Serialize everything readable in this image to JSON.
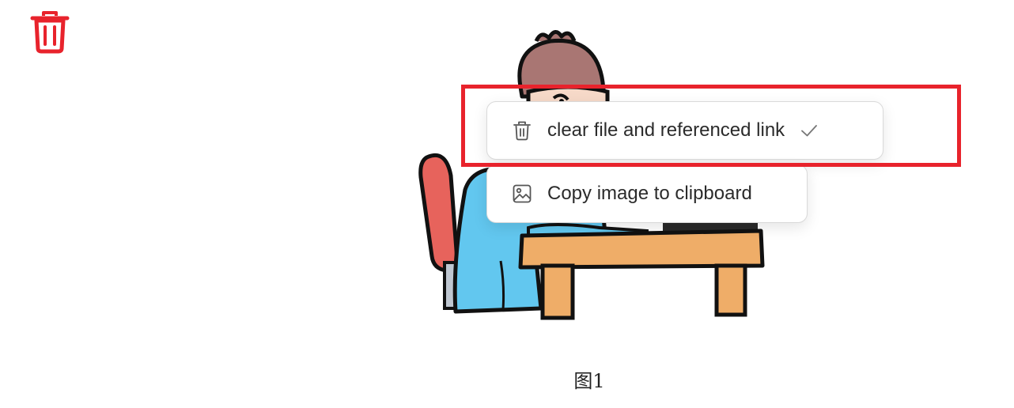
{
  "context_menu": {
    "items": [
      {
        "label": "clear file and referenced link",
        "icon": "trash-icon",
        "checked": true
      },
      {
        "label": "Copy image to clipboard",
        "icon": "image-icon",
        "checked": false
      }
    ]
  },
  "figure": {
    "caption": "图1"
  },
  "colors": {
    "delete_red": "#e8232c",
    "highlight_red": "#e8232c"
  }
}
